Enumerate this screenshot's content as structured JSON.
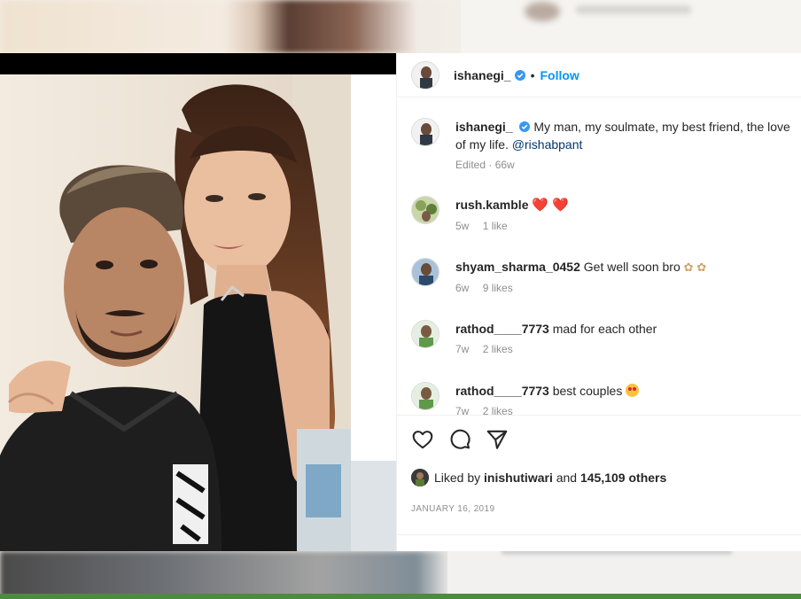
{
  "post": {
    "author": "ishanegi_",
    "follow_label": "Follow",
    "dot": "•",
    "caption": "My man, my soulmate, my best friend, the love of my life.",
    "caption_mention": "@rishabpant",
    "caption_meta": "Edited · 66w"
  },
  "comments": [
    {
      "user": "rush.kamble",
      "text": "",
      "emoji": "heart",
      "time": "5w",
      "likes": "1 like"
    },
    {
      "user": "shyam_sharma_0452",
      "text": "Get well soon bro",
      "emoji": "flower",
      "time": "6w",
      "likes": "9 likes"
    },
    {
      "user": "rathod____7773",
      "text": "mad for each other",
      "emoji": "",
      "time": "7w",
      "likes": "2 likes"
    },
    {
      "user": "rathod____7773",
      "text": "best couples",
      "emoji": "love-face",
      "time": "7w",
      "likes": "2 likes"
    }
  ],
  "likes": {
    "prefix": "Liked by",
    "user": "inishutiwari",
    "middle": "and",
    "count": "145,109 others"
  },
  "date": "JANUARY 16, 2019",
  "colors": {
    "accent": "#0095f6",
    "verified": "#3897f0",
    "text": "#262626",
    "muted": "#8e8e8e"
  }
}
